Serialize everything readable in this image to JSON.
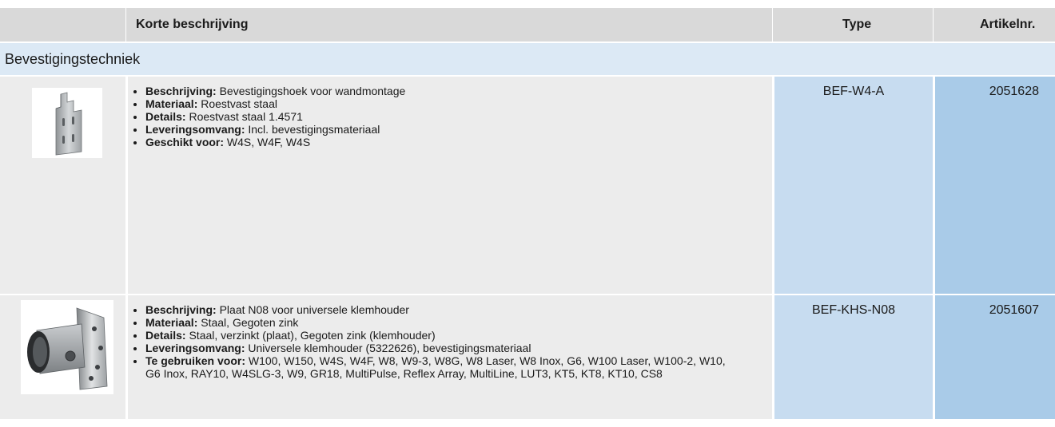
{
  "header": {
    "col_description": "Korte beschrijving",
    "col_type": "Type",
    "col_article": "Artikelnr."
  },
  "section": {
    "title": "Bevestigingstechniek"
  },
  "rows": [
    {
      "image_icon": "mounting-bracket-image",
      "type": "BEF-W4-A",
      "article": "2051628",
      "items": [
        {
          "label": "Beschrijving:",
          "value": " Bevestigingshoek voor wandmontage"
        },
        {
          "label": "Materiaal:",
          "value": " Roestvast staal"
        },
        {
          "label": "Details:",
          "value": " Roestvast staal 1.4571"
        },
        {
          "label": "Leveringsomvang:",
          "value": " Incl. bevestigingsmateriaal"
        },
        {
          "label": "Geschikt voor:",
          "value": " W4S, W4F, W4S"
        }
      ]
    },
    {
      "image_icon": "clamp-plate-image",
      "type": "BEF-KHS-N08",
      "article": "2051607",
      "items": [
        {
          "label": "Beschrijving:",
          "value": " Plaat N08 voor universele klemhouder"
        },
        {
          "label": "Materiaal:",
          "value": " Staal, Gegoten zink"
        },
        {
          "label": "Details:",
          "value": " Staal, verzinkt (plaat), Gegoten zink (klemhouder)"
        },
        {
          "label": "Leveringsomvang:",
          "value": " Universele klemhouder (5322626), bevestigingsmateriaal"
        },
        {
          "label": "Te gebruiken voor:",
          "value": " W100, W150, W4S, W4F, W8, W9-3, W8G, W8 Laser, W8 Inox, G6, W100 Laser, W100-2, W10, G6 Inox, RAY10, W4SLG-3, W9, GR18, MultiPulse, Reflex Array, MultiLine, LUT3, KT5, KT8, KT10, CS8"
        }
      ]
    }
  ]
}
